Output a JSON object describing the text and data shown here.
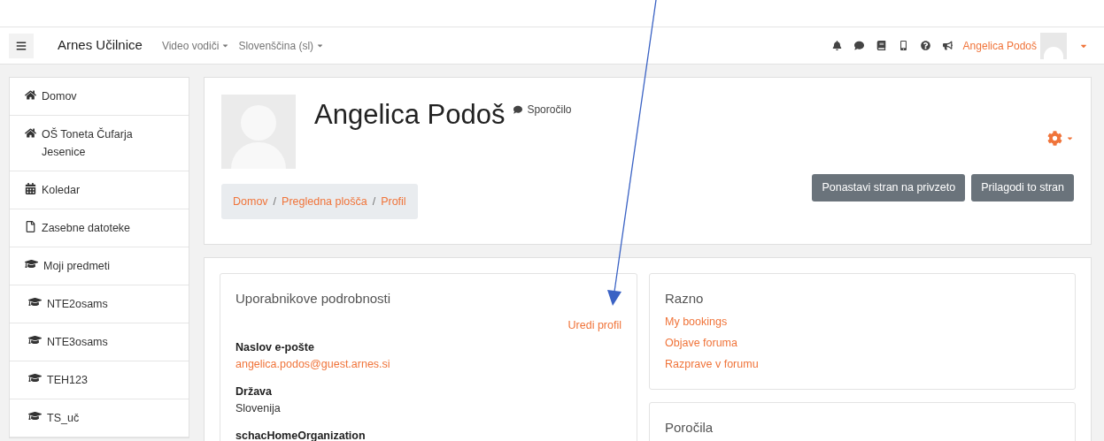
{
  "navbar": {
    "brand": "Arnes Učilnice",
    "menus": [
      {
        "label": "Video vodiči"
      },
      {
        "label": "Slovenščina (sl)"
      }
    ],
    "user_name": "Angelica Podoš"
  },
  "sidebar": {
    "items": [
      {
        "kind": "home",
        "label": "Domov"
      },
      {
        "kind": "home",
        "label": "OŠ Toneta Čufarja Jesenice"
      },
      {
        "kind": "calendar",
        "label": "Koledar"
      },
      {
        "kind": "file",
        "label": "Zasebne datoteke"
      },
      {
        "kind": "courses",
        "label": "Moji predmeti"
      },
      {
        "kind": "course",
        "label": "NTE2osams"
      },
      {
        "kind": "course",
        "label": "NTE3osams"
      },
      {
        "kind": "course",
        "label": "TEH123"
      },
      {
        "kind": "course",
        "label": "TS_uč"
      }
    ]
  },
  "profile_header": {
    "name": "Angelica Podoš",
    "message_link": "Sporočilo",
    "breadcrumb": [
      "Domov",
      "Pregledna plošča",
      "Profil"
    ],
    "breadcrumb_separator": "/",
    "buttons": [
      "Ponastavi stran na privzeto",
      "Prilagodi to stran"
    ]
  },
  "user_details": {
    "title": "Uporabnikove podrobnosti",
    "edit_link": "Uredi profil",
    "fields": [
      {
        "label": "Naslov e-pošte",
        "value": "angelica.podos@guest.arnes.si",
        "kind": "link"
      },
      {
        "label": "Država",
        "value": "Slovenija",
        "kind": "text"
      },
      {
        "label": "schacHomeOrganization"
      }
    ]
  },
  "misc": {
    "title": "Razno",
    "links": [
      "My bookings",
      "Objave foruma",
      "Razprave v forumu"
    ]
  },
  "reports": {
    "title": "Poročila"
  }
}
